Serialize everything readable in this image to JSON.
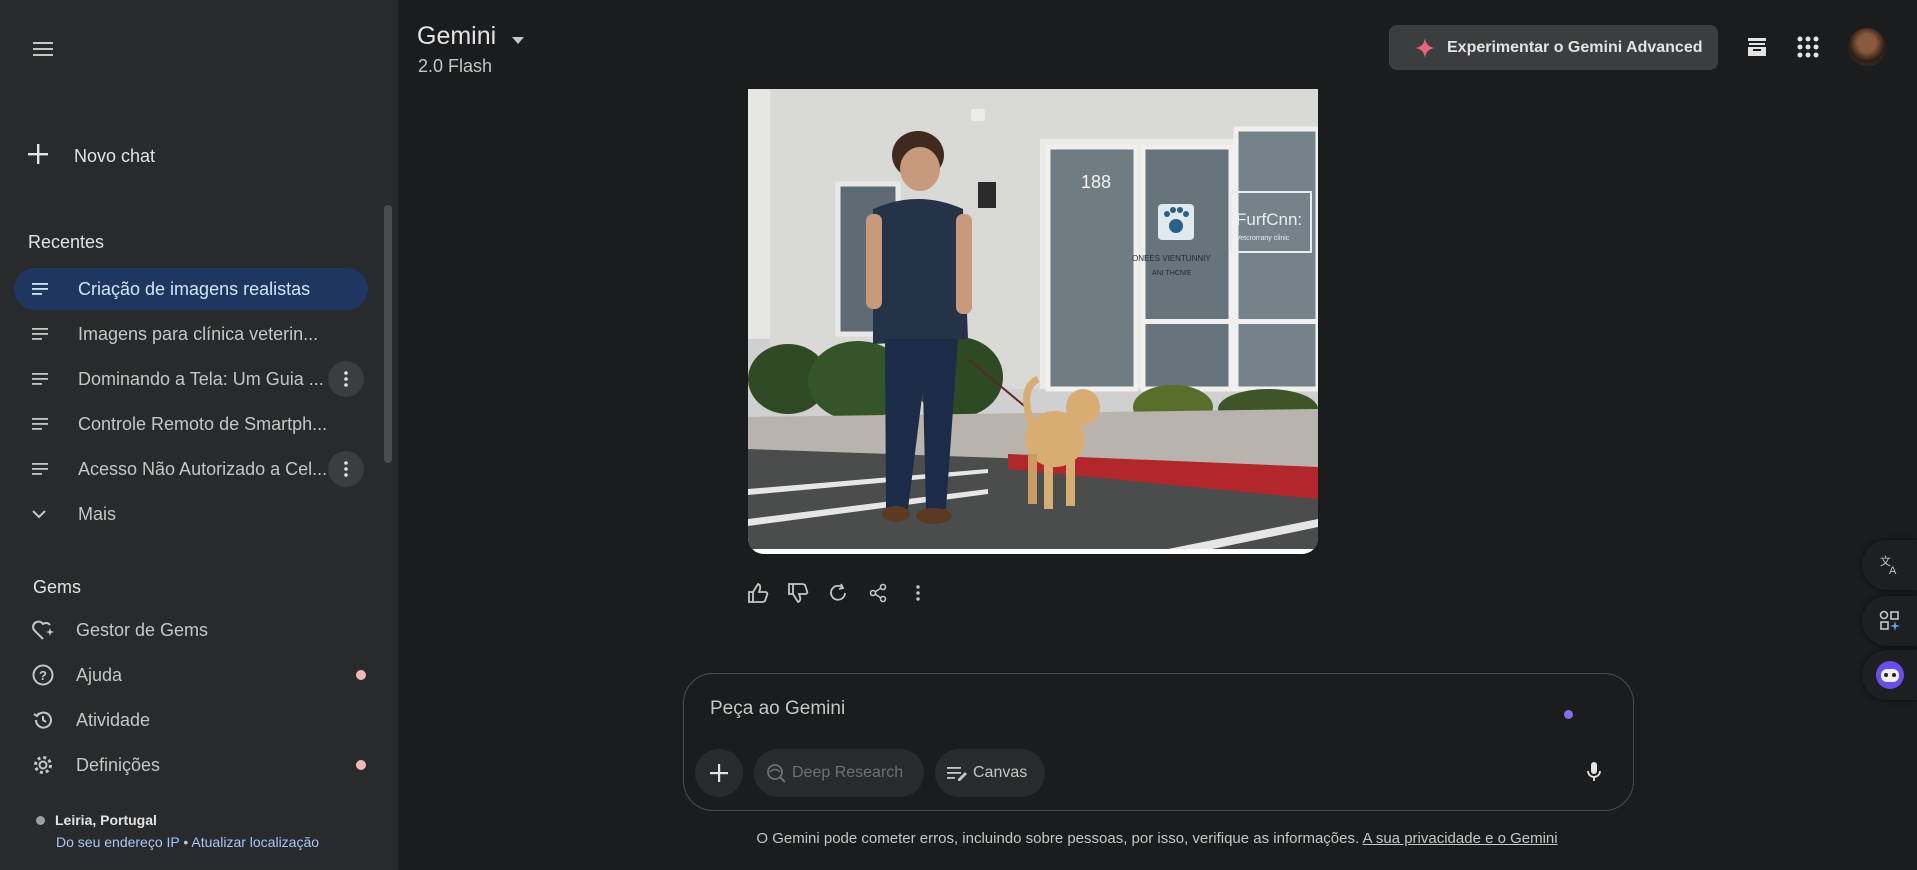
{
  "sidebar": {
    "new_chat_label": "Novo chat",
    "recent_title": "Recentes",
    "recent_items": [
      {
        "label": "Criação de imagens realistas"
      },
      {
        "label": "Imagens para clínica veterin..."
      },
      {
        "label": "Dominando a Tela: Um Guia ..."
      },
      {
        "label": "Controle Remoto de Smartph..."
      },
      {
        "label": "Acesso Não Autorizado a Cel..."
      }
    ],
    "more_label": "Mais",
    "gems_title": "Gems",
    "links": {
      "gem_manager": "Gestor de Gems",
      "help": "Ajuda",
      "activity": "Atividade",
      "settings": "Definições"
    },
    "location": {
      "place": "Leiria, Portugal",
      "source": "Do seu endereço IP",
      "separator": "•",
      "update": "Atualizar localização"
    }
  },
  "header": {
    "title": "Gemini",
    "model": "2.0 Flash",
    "advanced_button": "Experimentar o Gemini Advanced"
  },
  "image": {
    "building_number": "188",
    "sign_text": "FurfCnn:",
    "sign_sub": "Vetcrorrany clinic",
    "window_text": "ONEES VIENTUNNIY",
    "window_sub": "ANI THCNIE"
  },
  "composer": {
    "placeholder": "Peça ao Gemini",
    "deep_research": "Deep Research",
    "canvas": "Canvas"
  },
  "footer": {
    "disclaimer": "O Gemini pode cometer erros, incluindo sobre pessoas, por isso, verifique as informações.",
    "privacy_link": "A sua privacidade e o Gemini"
  },
  "colors": {
    "background": "#1b1c1d",
    "sidebar": "#282a2c",
    "active_item": "#1f3760",
    "badge": "#f2b8b5",
    "link": "#a8c7fa"
  }
}
